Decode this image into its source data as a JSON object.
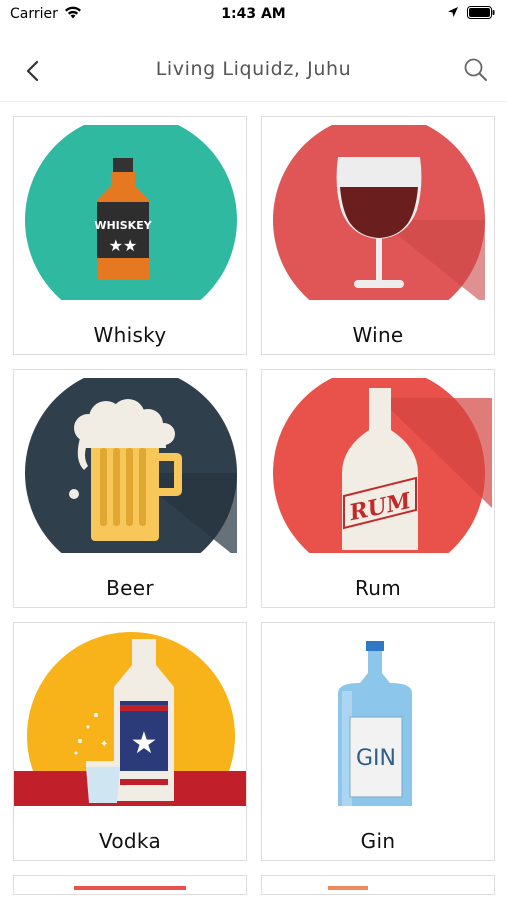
{
  "status_bar": {
    "carrier": "Carrier",
    "time": "1:43 AM"
  },
  "nav": {
    "title": "Living Liquidz, Juhu"
  },
  "categories": [
    {
      "label": "Whisky",
      "icon": "whiskey-bottle-icon",
      "bg": "#2fb9a0"
    },
    {
      "label": "Wine",
      "icon": "wine-glass-icon",
      "bg": "#e05555"
    },
    {
      "label": "Beer",
      "icon": "beer-mug-icon",
      "bg": "#2f3f4c"
    },
    {
      "label": "Rum",
      "icon": "rum-bottle-icon",
      "bg": "#e9524a"
    },
    {
      "label": "Vodka",
      "icon": "vodka-bottle-icon",
      "bg": "#f8b31a"
    },
    {
      "label": "Gin",
      "icon": "gin-bottle-icon",
      "bg": "#ffffff"
    }
  ],
  "bottle_text": {
    "whiskey": "WHISKEY",
    "rum": "RUM",
    "gin": "GIN"
  }
}
